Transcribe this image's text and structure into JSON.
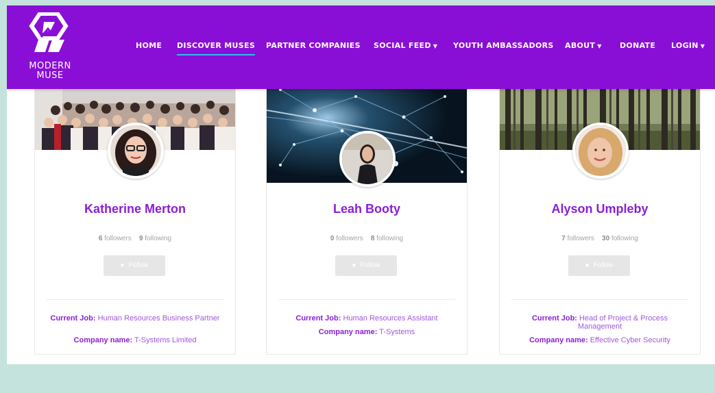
{
  "brand": {
    "line1": "MODERN",
    "line2": "MUSE",
    "color": "#8a0fd6"
  },
  "nav": {
    "items": [
      {
        "label": "HOME",
        "dropdown": false,
        "active": false
      },
      {
        "label": "DISCOVER MUSES",
        "dropdown": false,
        "active": true
      },
      {
        "label": "PARTNER COMPANIES",
        "dropdown": false,
        "active": false
      },
      {
        "label": "SOCIAL FEED",
        "dropdown": true,
        "active": false
      },
      {
        "label": "YOUTH AMBASSADORS",
        "dropdown": false,
        "active": false
      },
      {
        "label": "ABOUT",
        "dropdown": true,
        "active": false
      },
      {
        "label": "DONATE",
        "dropdown": false,
        "active": false
      },
      {
        "label": "LOGIN",
        "dropdown": true,
        "active": false
      }
    ],
    "active_underline_color": "#29c2f0"
  },
  "cards": [
    {
      "name": "Katherine Merton",
      "followers": "6",
      "followers_label": "followers",
      "following": "9",
      "following_label": "following",
      "follow_label": "Follow",
      "job_label": "Current Job:",
      "job": "Human Resources Business Partner",
      "company_label": "Company name:",
      "company": "T-Systems Limited",
      "banner": "group-photo"
    },
    {
      "name": "Leah Booty",
      "followers": "0",
      "followers_label": "followers",
      "following": "8",
      "following_label": "following",
      "follow_label": "Follow",
      "job_label": "Current Job:",
      "job": "Human Resources Assistant",
      "company_label": "Company name:",
      "company": "T-Systems",
      "banner": "network-space"
    },
    {
      "name": "Alyson Umpleby",
      "followers": "7",
      "followers_label": "followers",
      "following": "30",
      "following_label": "following",
      "follow_label": "Follow",
      "job_label": "Current Job:",
      "job": "Head of Project & Process Management",
      "company_label": "Company name:",
      "company": "Effective Cyber Security",
      "banner": "forest"
    }
  ],
  "icons": {
    "logo": "modern-muse-logo",
    "dropdown": "chevron-down-icon",
    "follow": "user-icon"
  }
}
